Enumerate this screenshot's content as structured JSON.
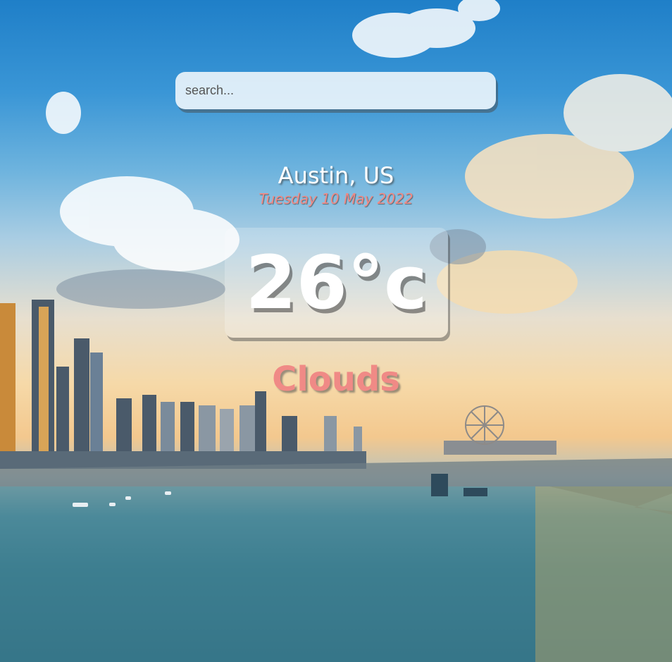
{
  "search": {
    "placeholder": "search..."
  },
  "location": {
    "city": "Austin, US",
    "date": "Tuesday 10 May 2022"
  },
  "weather": {
    "temperature": "26°c",
    "condition": "Clouds"
  },
  "colors": {
    "accent": "#f08a86",
    "text": "#ffffff"
  }
}
